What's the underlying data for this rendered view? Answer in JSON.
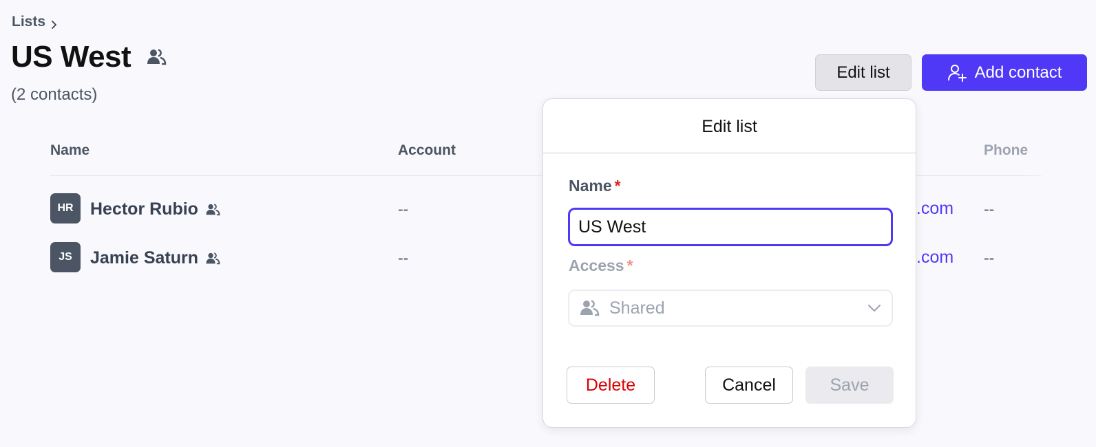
{
  "breadcrumb": {
    "label": "Lists"
  },
  "header": {
    "title": "US West",
    "subtitle": "(2 contacts)",
    "edit_list_label": "Edit list",
    "add_contact_label": "Add contact"
  },
  "table": {
    "columns": {
      "name": "Name",
      "account": "Account",
      "phone": "Phone"
    },
    "rows": [
      {
        "initials": "HR",
        "name": "Hector Rubio",
        "account": "--",
        "email_fragment": "g.com",
        "phone": "--"
      },
      {
        "initials": "JS",
        "name": "Jamie Saturn",
        "account": "--",
        "email_fragment": ".com",
        "phone": "--"
      }
    ]
  },
  "modal": {
    "title": "Edit list",
    "name_label": "Name",
    "required_mark": "*",
    "name_value": "US West",
    "access_label": "Access",
    "access_value": "Shared",
    "delete_label": "Delete",
    "cancel_label": "Cancel",
    "save_label": "Save"
  },
  "colors": {
    "accent": "#4f39f6",
    "danger": "#dc0000"
  }
}
